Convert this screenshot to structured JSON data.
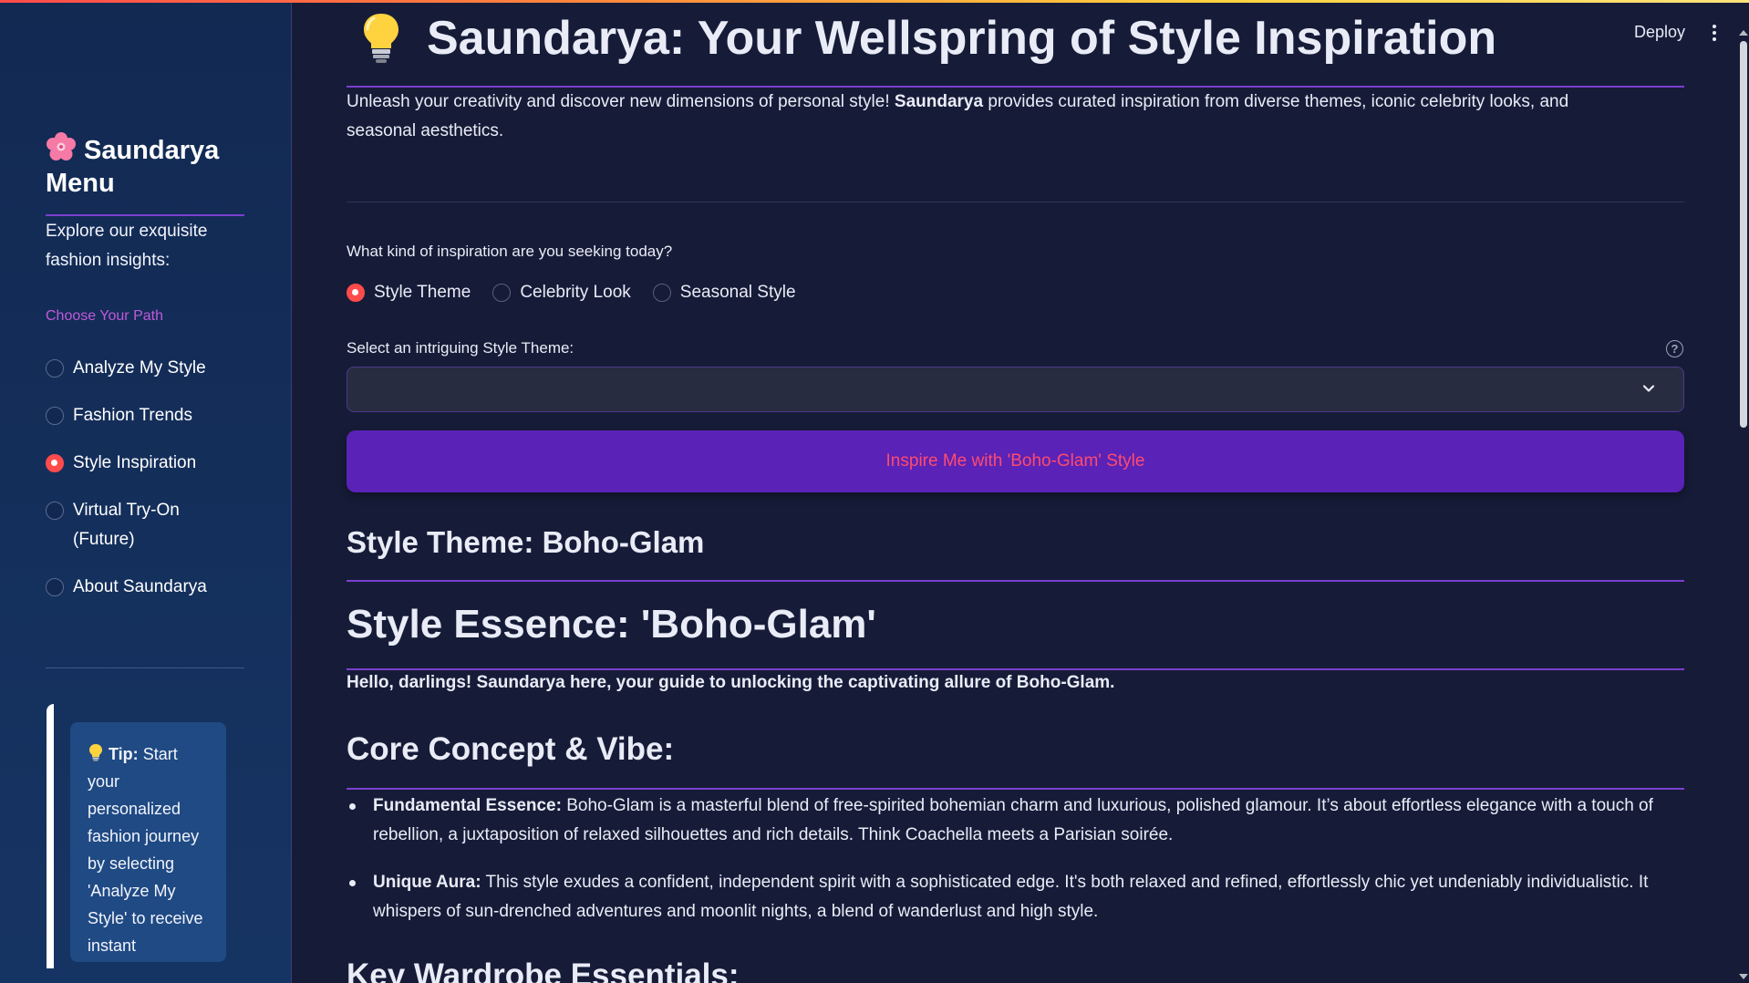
{
  "sidebar": {
    "title": "Saundarya Menu",
    "title_icon": "cherry-blossom-icon",
    "explore_text": "Explore our exquisite fashion insights:",
    "choose_label": "Choose Your Path",
    "nav_items": [
      {
        "label": "Analyze My Style",
        "selected": false
      },
      {
        "label": "Fashion Trends",
        "selected": false
      },
      {
        "label": "Style Inspiration",
        "selected": true
      },
      {
        "label": "Virtual Try-On (Future)",
        "selected": false
      },
      {
        "label": "About Saundarya",
        "selected": false
      }
    ],
    "tip": {
      "icon": "lightbulb-icon",
      "bold": "Tip:",
      "text": " Start your personalized fashion journey by selecting 'Analyze My Style' to receive instant"
    }
  },
  "header": {
    "deploy_label": "Deploy",
    "menu_icon": "kebab-menu-icon"
  },
  "main": {
    "title_icon": "lightbulb-icon",
    "title": "Saundarya: Your Wellspring of Style Inspiration",
    "intro_before": "Unleash your creativity and discover new dimensions of personal style! ",
    "intro_bold": "Saundarya",
    "intro_after": " provides curated inspiration from diverse themes, iconic celebrity looks, and seasonal aesthetics.",
    "question_label": "What kind of inspiration are you seeking today?",
    "inspiration_options": [
      {
        "label": "Style Theme",
        "selected": true
      },
      {
        "label": "Celebrity Look",
        "selected": false
      },
      {
        "label": "Seasonal Style",
        "selected": false
      }
    ],
    "select_label": "Select an intriguing Style Theme:",
    "select_value": "",
    "inspire_button": "Inspire Me with 'Boho-Glam' Style",
    "theme_heading": "Style Theme: Boho-Glam",
    "essence_heading": "Style Essence: 'Boho-Glam'",
    "hello_text": "Hello, darlings! Saundarya here, your guide to unlocking the captivating allure of Boho-Glam.",
    "core_heading": "Core Concept & Vibe:",
    "bullets": [
      {
        "bold": "Fundamental Essence:",
        "text": " Boho-Glam is a masterful blend of free-spirited bohemian charm and luxurious, polished glamour. It’s about effortless elegance with a touch of rebellion, a juxtaposition of relaxed silhouettes and rich details. Think Coachella meets a Parisian soirée."
      },
      {
        "bold": "Unique Aura:",
        "text": " This style exudes a confident, independent spirit with a sophisticated edge. It's both relaxed and refined, effortlessly chic yet undeniably individualistic. It whispers of sun-drenched adventures and moonlit nights, a blend of wanderlust and high style."
      }
    ],
    "key_heading": "Key Wardrobe Essentials:"
  },
  "colors": {
    "background": "#161c38",
    "sidebar": "#122952",
    "accent_purple": "#7b3fd0",
    "button": "#5a22b6",
    "radio_selected": "#ff4b4b",
    "button_text": "#ff4b6e"
  }
}
